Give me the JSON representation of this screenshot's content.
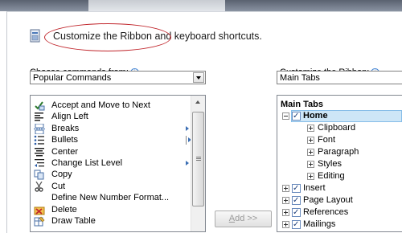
{
  "headline": "Customize the Ribbon and keyboard shortcuts.",
  "left": {
    "label_pre": "",
    "label_accel": "C",
    "label_post": "hoose commands from:",
    "info": "i",
    "select_value": "Popular Commands",
    "commands": [
      {
        "label": "Accept and Move to Next",
        "icon": "accept-icon",
        "submenu": false
      },
      {
        "label": "Align Left",
        "icon": "align-left-icon",
        "submenu": false
      },
      {
        "label": "Breaks",
        "icon": "breaks-icon",
        "submenu": true
      },
      {
        "label": "Bullets",
        "icon": "bullets-icon",
        "submenu": true,
        "split": true
      },
      {
        "label": "Center",
        "icon": "center-icon",
        "submenu": false
      },
      {
        "label": "Change List Level",
        "icon": "list-level-icon",
        "submenu": true
      },
      {
        "label": "Copy",
        "icon": "copy-icon",
        "submenu": false
      },
      {
        "label": "Cut",
        "icon": "cut-icon",
        "submenu": false
      },
      {
        "label": "Define New Number Format...",
        "icon": "",
        "submenu": false
      },
      {
        "label": "Delete",
        "icon": "delete-icon",
        "submenu": false
      },
      {
        "label": "Draw Table",
        "icon": "draw-table-icon",
        "submenu": false
      }
    ]
  },
  "add_button": {
    "pre": "",
    "accel": "A",
    "post": "dd >>"
  },
  "right": {
    "label_pre": "Customize the Ri",
    "label_accel": "b",
    "label_post": "bon:",
    "info": "i",
    "select_value": "Main Tabs",
    "tree_header": "Main Tabs",
    "home": "Home",
    "groups": [
      "Clipboard",
      "Font",
      "Paragraph",
      "Styles",
      "Editing"
    ],
    "tabs": [
      "Insert",
      "Page Layout",
      "References",
      "Mailings"
    ]
  }
}
